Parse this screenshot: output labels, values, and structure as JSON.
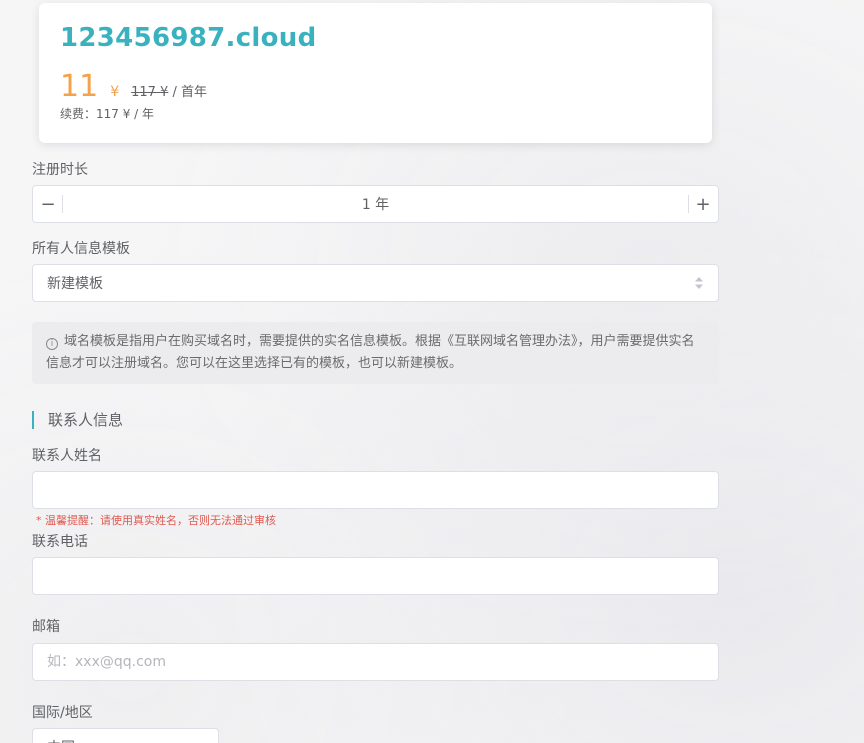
{
  "card": {
    "domain": "123456987.cloud",
    "price": "11",
    "currency": "¥",
    "original_price": "117 ¥",
    "original_suffix": " / 首年",
    "renewal": "续费：117 ¥ / 年"
  },
  "form": {
    "duration_label": "注册时长",
    "duration_minus": "−",
    "duration_plus": "+",
    "duration_value": "1 年",
    "template_label": "所有人信息模板",
    "template_value": "新建模板",
    "notice_text": "域名模板是指用户在购买域名时，需要提供的实名信息模板。根据《互联网域名管理办法》，用户需要提供实名信息才可以注册域名。您可以在这里选择已有的模板，也可以新建模板。",
    "contact_section_title": "联系人信息",
    "name_label": "联系人姓名",
    "name_value": "",
    "name_hint": "* 温馨提醒：请使用真实姓名，否则无法通过审核",
    "phone_label": "联系电话",
    "phone_value": "",
    "email_label": "邮箱",
    "email_placeholder": "如：xxx@qq.com",
    "country_label": "国际/地区",
    "country_value": "中国"
  },
  "colors": {
    "accent": "#3ab1be",
    "price": "#f3a14a",
    "hint": "#e05a50"
  },
  "icons": {
    "notice": "info-circle-icon",
    "select": "sort-updown-icon"
  }
}
